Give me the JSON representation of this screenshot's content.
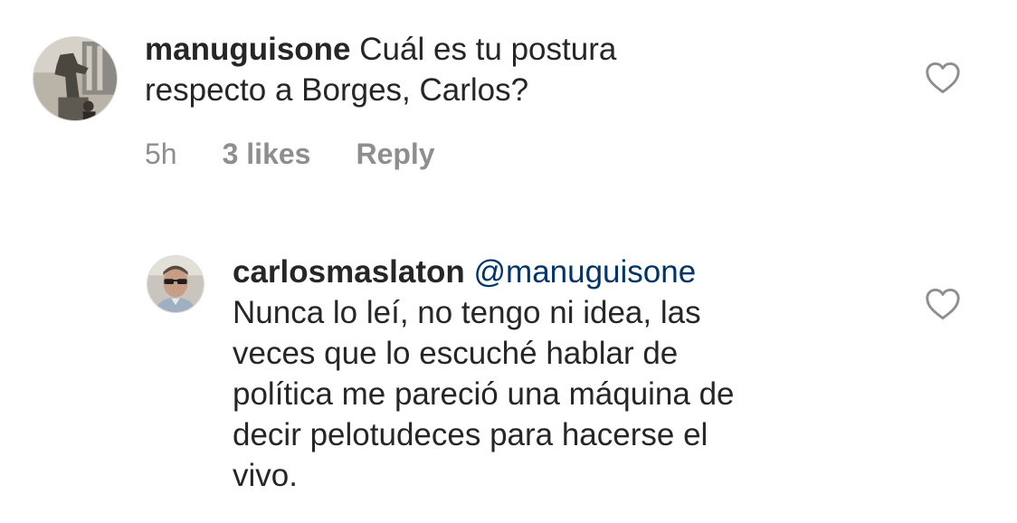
{
  "comment": {
    "username": "manuguisone",
    "text_line1": "Cuál es tu postura",
    "text_line2": "respecto a Borges, Carlos?",
    "time": "5h",
    "likes": "3 likes",
    "reply": "Reply",
    "avatar_icon": "avatar-statue-photo",
    "like_icon": "heart-outline-icon"
  },
  "reply": {
    "username": "carlosmaslaton",
    "mention": "@manuguisone",
    "lines": [
      "Nunca lo leí, no tengo ni idea, las",
      "veces que lo escuché hablar de",
      "política me pareció una máquina de",
      "decir pelotudeces para hacerse el",
      "vivo."
    ],
    "avatar_icon": "avatar-man-sunglasses-photo",
    "like_icon": "heart-outline-icon"
  },
  "colors": {
    "text": "#262626",
    "meta": "#8e8e8e",
    "mention": "#003569"
  }
}
